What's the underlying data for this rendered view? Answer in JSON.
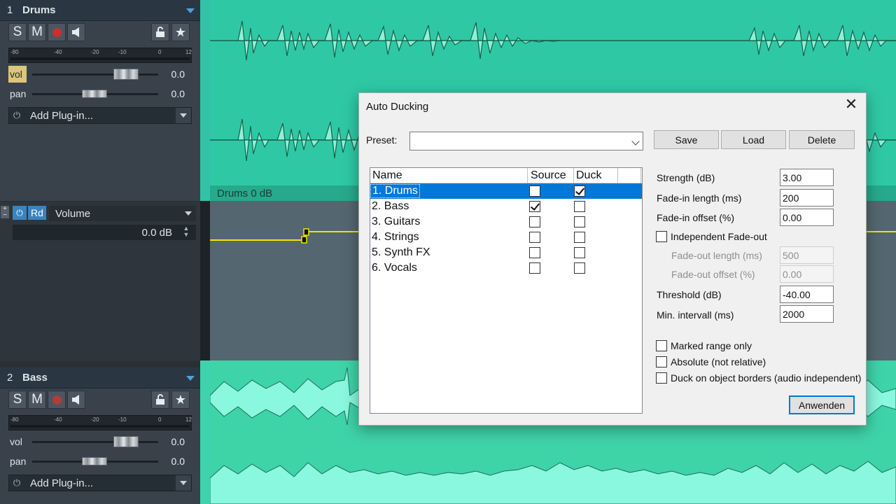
{
  "tracks": [
    {
      "number": "1",
      "name": "Drums",
      "buttons": {
        "solo": "S",
        "mute": "M"
      },
      "meter_scale": [
        "-80",
        "-40",
        "-20",
        "-10",
        "0",
        "12"
      ],
      "vol_label": "vol",
      "vol_value": "0.0",
      "pan_label": "pan",
      "pan_value": "0.0",
      "plugin_label": "Add Plug-in..."
    },
    {
      "number": "2",
      "name": "Bass",
      "buttons": {
        "solo": "S",
        "mute": "M"
      },
      "meter_scale": [
        "-80",
        "-40",
        "-20",
        "-10",
        "0",
        "12"
      ],
      "vol_label": "vol",
      "vol_value": "0.0",
      "pan_label": "pan",
      "pan_value": "0.0",
      "plugin_label": "Add Plug-in..."
    }
  ],
  "automation": {
    "mode": "Rd",
    "parameter": "Volume",
    "value": "0.0 dB"
  },
  "clip_label": "Drums   0 dB",
  "colors": {
    "track1_clip": "#2fc8a5",
    "track2_clip": "#3fd3a8",
    "automation_line": "#f2e600",
    "selection": "#0078d7"
  },
  "dialog": {
    "title": "Auto Ducking",
    "close_icon": "close-icon",
    "preset_label": "Preset:",
    "preset_value": "",
    "buttons": {
      "save": "Save",
      "load": "Load",
      "delete": "Delete",
      "apply": "Anwenden"
    },
    "list": {
      "headers": {
        "name": "Name",
        "source": "Source",
        "duck": "Duck"
      },
      "rows": [
        {
          "name": "1.  Drums",
          "source": false,
          "duck": true,
          "selected": true
        },
        {
          "name": "2.  Bass",
          "source": true,
          "duck": false,
          "selected": false
        },
        {
          "name": "3.  Guitars",
          "source": false,
          "duck": false,
          "selected": false
        },
        {
          "name": "4.  Strings",
          "source": false,
          "duck": false,
          "selected": false
        },
        {
          "name": "5.  Synth FX",
          "source": false,
          "duck": false,
          "selected": false
        },
        {
          "name": "6.  Vocals",
          "source": false,
          "duck": false,
          "selected": false
        }
      ]
    },
    "params": {
      "strength_label": "Strength (dB)",
      "strength": "3.00",
      "fadein_len_label": "Fade-in length (ms)",
      "fadein_len": "200",
      "fadein_off_label": "Fade-in offset (%)",
      "fadein_off": "0.00",
      "indep_fadeout_label": "Independent Fade-out",
      "fadeout_len_label": "Fade-out length (ms)",
      "fadeout_len": "500",
      "fadeout_off_label": "Fade-out offset (%)",
      "fadeout_off": "0.00",
      "threshold_label": "Threshold (dB)",
      "threshold": "-40.00",
      "min_interval_label": "Min. intervall (ms)",
      "min_interval": "2000"
    },
    "options": {
      "marked_range": "Marked range only",
      "absolute": "Absolute (not relative)",
      "duck_borders": "Duck on object borders (audio independent)"
    }
  }
}
